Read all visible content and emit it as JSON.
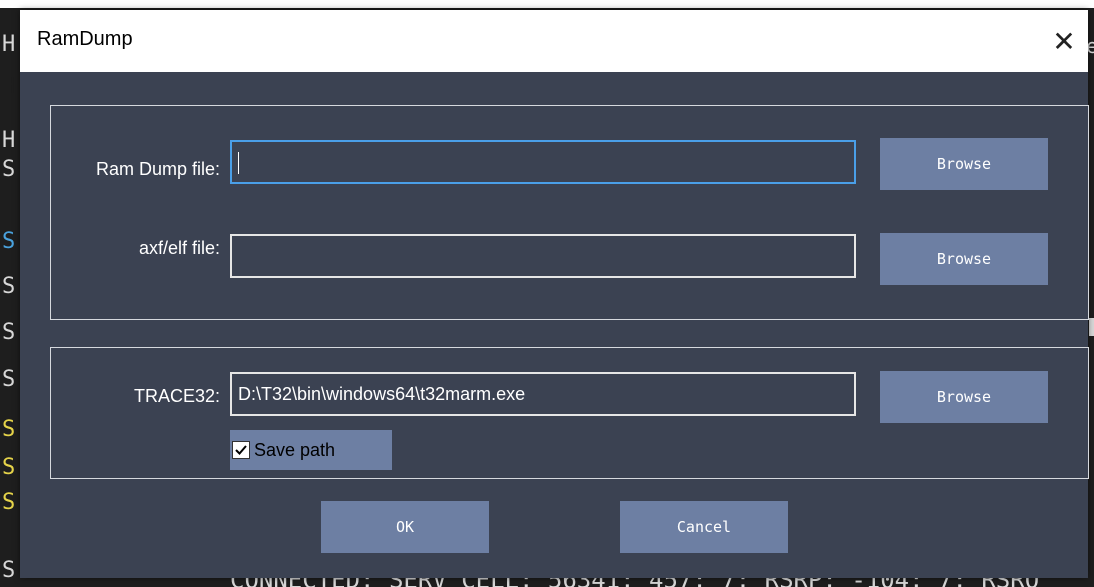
{
  "dialog": {
    "title": "RamDump",
    "close_glyph": "✕",
    "ram_dump": {
      "label": "Ram Dump file:",
      "value": "",
      "browse_label": "Browse"
    },
    "axf": {
      "label": "axf/elf file:",
      "value": "",
      "browse_label": "Browse"
    },
    "trace32": {
      "label": "TRACE32:",
      "value": "D:\\T32\\bin\\windows64\\t32marm.exe",
      "browse_label": "Browse"
    },
    "save_path": {
      "label": "Save path",
      "checked": true
    },
    "ok_label": "OK",
    "cancel_label": "Cancel"
  },
  "background": {
    "letters": [
      {
        "char": "H",
        "color": "#d8d8d8"
      },
      {
        "char": "H",
        "color": "#1e1e1e"
      },
      {
        "char": "H",
        "color": "#d8d8d8"
      },
      {
        "char": "S",
        "color": "#d8d8d8"
      },
      {
        "char": "S",
        "color": "#4aa3df"
      },
      {
        "char": "S",
        "color": "#d8d8d8"
      },
      {
        "char": "S",
        "color": "#d8d8d8"
      },
      {
        "char": "S",
        "color": "#d8d8d8"
      },
      {
        "char": "S",
        "color": "#e6d44a"
      },
      {
        "char": "S",
        "color": "#e6d44a"
      },
      {
        "char": "S",
        "color": "#e6d44a"
      },
      {
        "char": "S",
        "color": "#d8d8d8"
      }
    ],
    "bottom_text": "CONNECTED: SERV CELL: 56341: 457: 7: RSRP: -104: 7: RSRQ",
    "right_char": "e"
  },
  "colors": {
    "dialog_bg": "#3b4252",
    "button_bg": "#6d7fa3",
    "focus_border": "#4a9fe8"
  }
}
